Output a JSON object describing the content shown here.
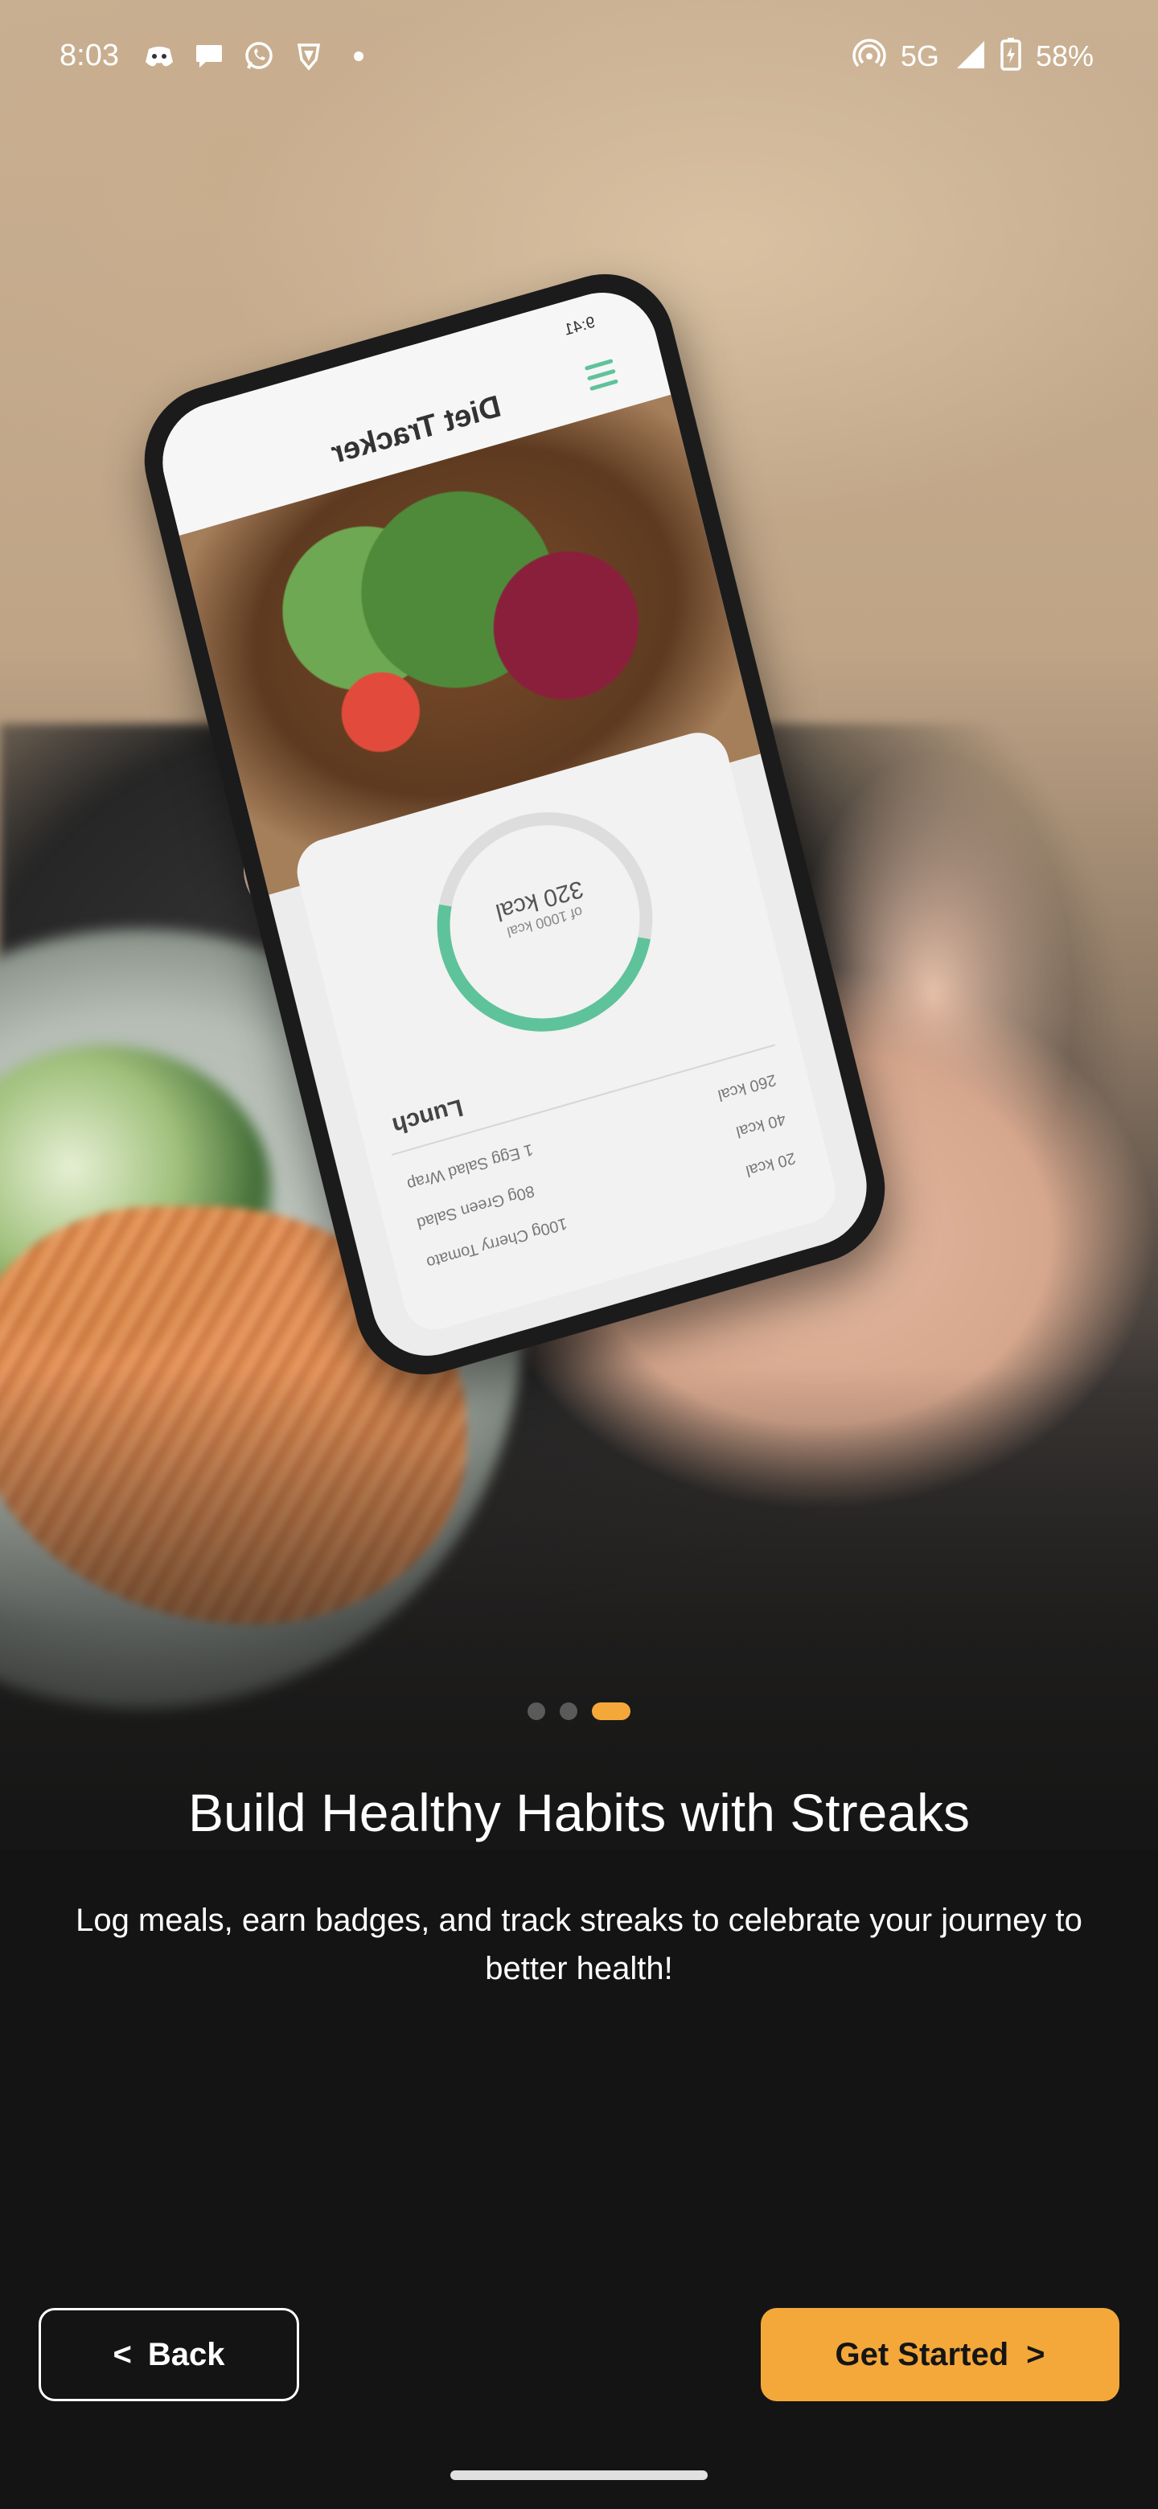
{
  "status_bar": {
    "time": "8:03",
    "network": "5G",
    "battery": "58%",
    "notification_icons": [
      "discord-icon",
      "chat-icon",
      "whatsapp-icon",
      "vpn-icon",
      "dot-icon"
    ]
  },
  "mockup": {
    "app_title": "Diet Tracker",
    "time": "9:41",
    "kcal_main": "320 kcal",
    "kcal_sub": "of 1000 kcal",
    "meal_title": "Lunch",
    "items": [
      {
        "name": "1 Egg Salad Wrap",
        "kcal": "260 kcal"
      },
      {
        "name": "80g Green Salad",
        "kcal": "40 kcal"
      },
      {
        "name": "100g Cherry Tomato",
        "kcal": "20 kcal"
      }
    ],
    "progress_fraction": 0.32,
    "accent": "#5ec39a"
  },
  "pager": {
    "count": 3,
    "active_index": 2,
    "active_color": "#f4a83a"
  },
  "onboarding": {
    "title": "Build Healthy Habits with Streaks",
    "description": "Log meals, earn badges, and track streaks to celebrate your journey to better health!"
  },
  "buttons": {
    "back_chevron": "<",
    "back_label": "Back",
    "start_label": "Get Started",
    "start_chevron": ">",
    "start_color": "#f4a83a"
  }
}
